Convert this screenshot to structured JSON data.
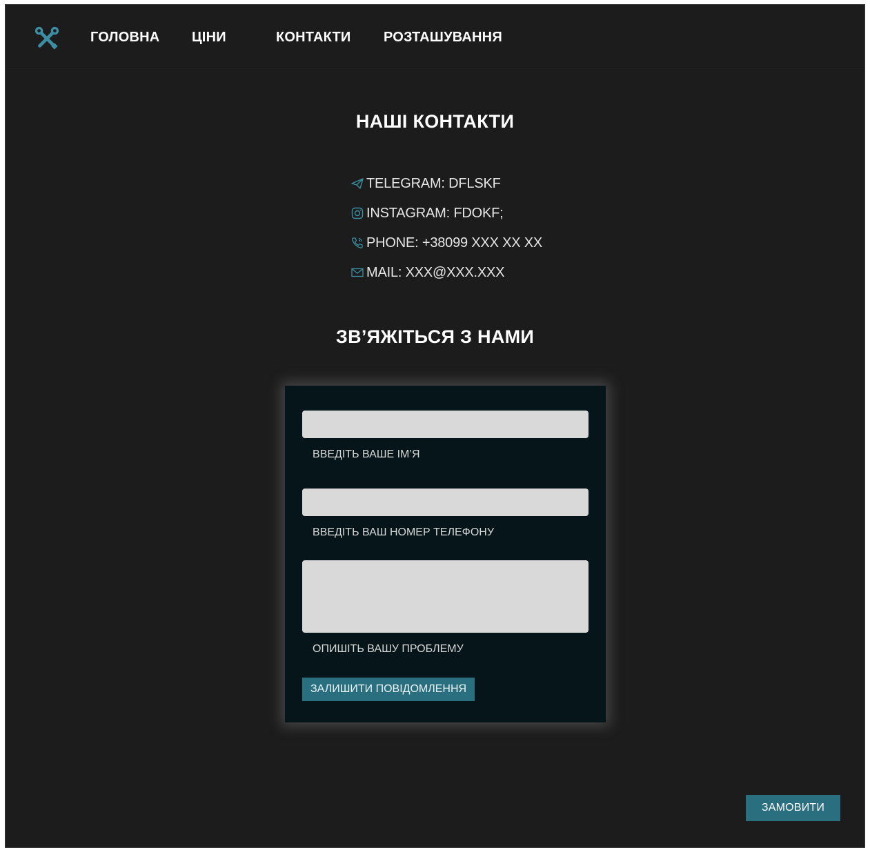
{
  "nav": {
    "logo_icon": "tools-icon",
    "links": [
      {
        "label": "ГОЛОВНА"
      },
      {
        "label": "ЦІНИ"
      },
      {
        "label": "КОНТАКТИ"
      },
      {
        "label": "РОЗТАШУВАННЯ"
      }
    ]
  },
  "contacts": {
    "title": "НАШІ КОНТАКТИ",
    "items": [
      {
        "icon": "telegram-icon",
        "text": "TELEGRAM: DFLSKF"
      },
      {
        "icon": "instagram-icon",
        "text": "INSTAGRAM: FDOKF;"
      },
      {
        "icon": "phone-icon",
        "text": "PHONE: +38099 XXX XX XX"
      },
      {
        "icon": "mail-icon",
        "text": "MAIL: XXX@XXX.XXX"
      }
    ]
  },
  "contact_form": {
    "title": "ЗВ’ЯЖІТЬСЯ З НАМИ",
    "name_field": {
      "value": "",
      "label": "ВВЕДІТЬ ВАШЕ ІМ’Я"
    },
    "phone_field": {
      "value": "",
      "label": "ВВЕДІТЬ ВАШ НОМЕР ТЕЛЕФОНУ"
    },
    "problem_field": {
      "value": "",
      "label": "ОПИШІТЬ ВАШУ ПРОБЛЕМУ"
    },
    "submit_label": "ЗАЛИШИТИ ПОВІДОМЛЕННЯ"
  },
  "order_button": {
    "label": "ЗАМОВИТИ"
  },
  "colors": {
    "background": "#1c1c1c",
    "panel": "#051519",
    "accent": "#2a6f80",
    "field": "#d9d9d9",
    "icon": "#3c8fa3"
  }
}
